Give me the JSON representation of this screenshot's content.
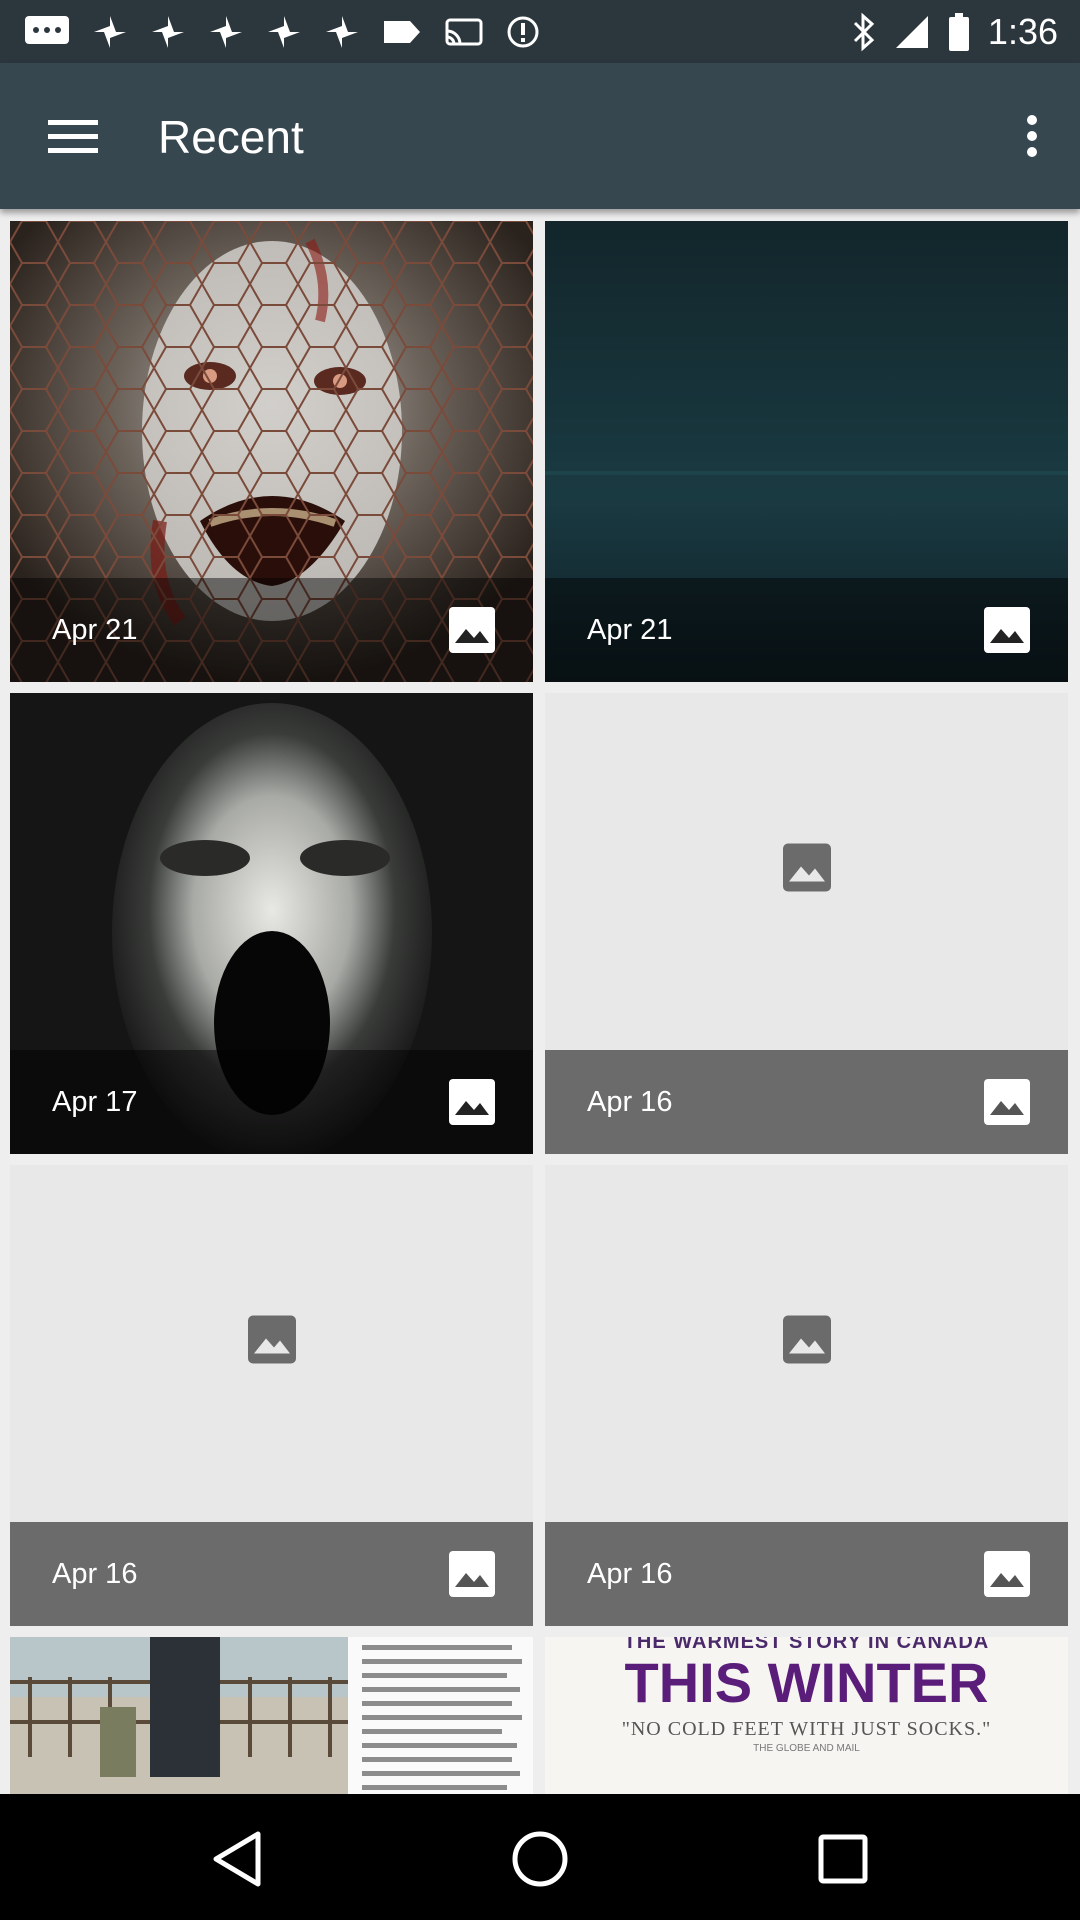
{
  "status_bar": {
    "time": "1:36",
    "left_icons": [
      "message-icon",
      "pinwheel-icon",
      "pinwheel-icon",
      "pinwheel-icon",
      "pinwheel-icon",
      "pinwheel-icon",
      "tag-icon",
      "cast-icon",
      "alert-circle-icon"
    ],
    "right_icons": [
      "bluetooth-icon",
      "signal-icon",
      "battery-icon"
    ]
  },
  "app_bar": {
    "title": "Recent",
    "menu_icon": "hamburger-menu-icon",
    "overflow_icon": "more-vert-icon"
  },
  "grid": {
    "items": [
      {
        "date": "Apr 21",
        "thumbnail": "zombie-face"
      },
      {
        "date": "Apr 21",
        "thumbnail": "dark-teal"
      },
      {
        "date": "Apr 17",
        "thumbnail": "screaming-face"
      },
      {
        "date": "Apr 16",
        "thumbnail": "placeholder"
      },
      {
        "date": "Apr 16",
        "thumbnail": "placeholder"
      },
      {
        "date": "Apr 16",
        "thumbnail": "placeholder"
      }
    ],
    "partial_items": [
      {
        "thumbnail": "bridge-photo-article"
      },
      {
        "thumbnail": "poster",
        "poster_top": "THE WARMEST STORY IN CANADA",
        "poster_title": "THIS WINTER",
        "poster_quote": "\"NO COLD FEET WITH JUST SOCKS.\"",
        "poster_source": "THE GLOBE AND MAIL"
      }
    ]
  },
  "nav_bar": {
    "icons": [
      "back-icon",
      "home-icon",
      "recents-icon"
    ]
  },
  "colors": {
    "app_bar": "#37474f",
    "status_bar": "#2b363d",
    "caption_overlay": "#6b6b6b",
    "background": "#eeeeee"
  }
}
